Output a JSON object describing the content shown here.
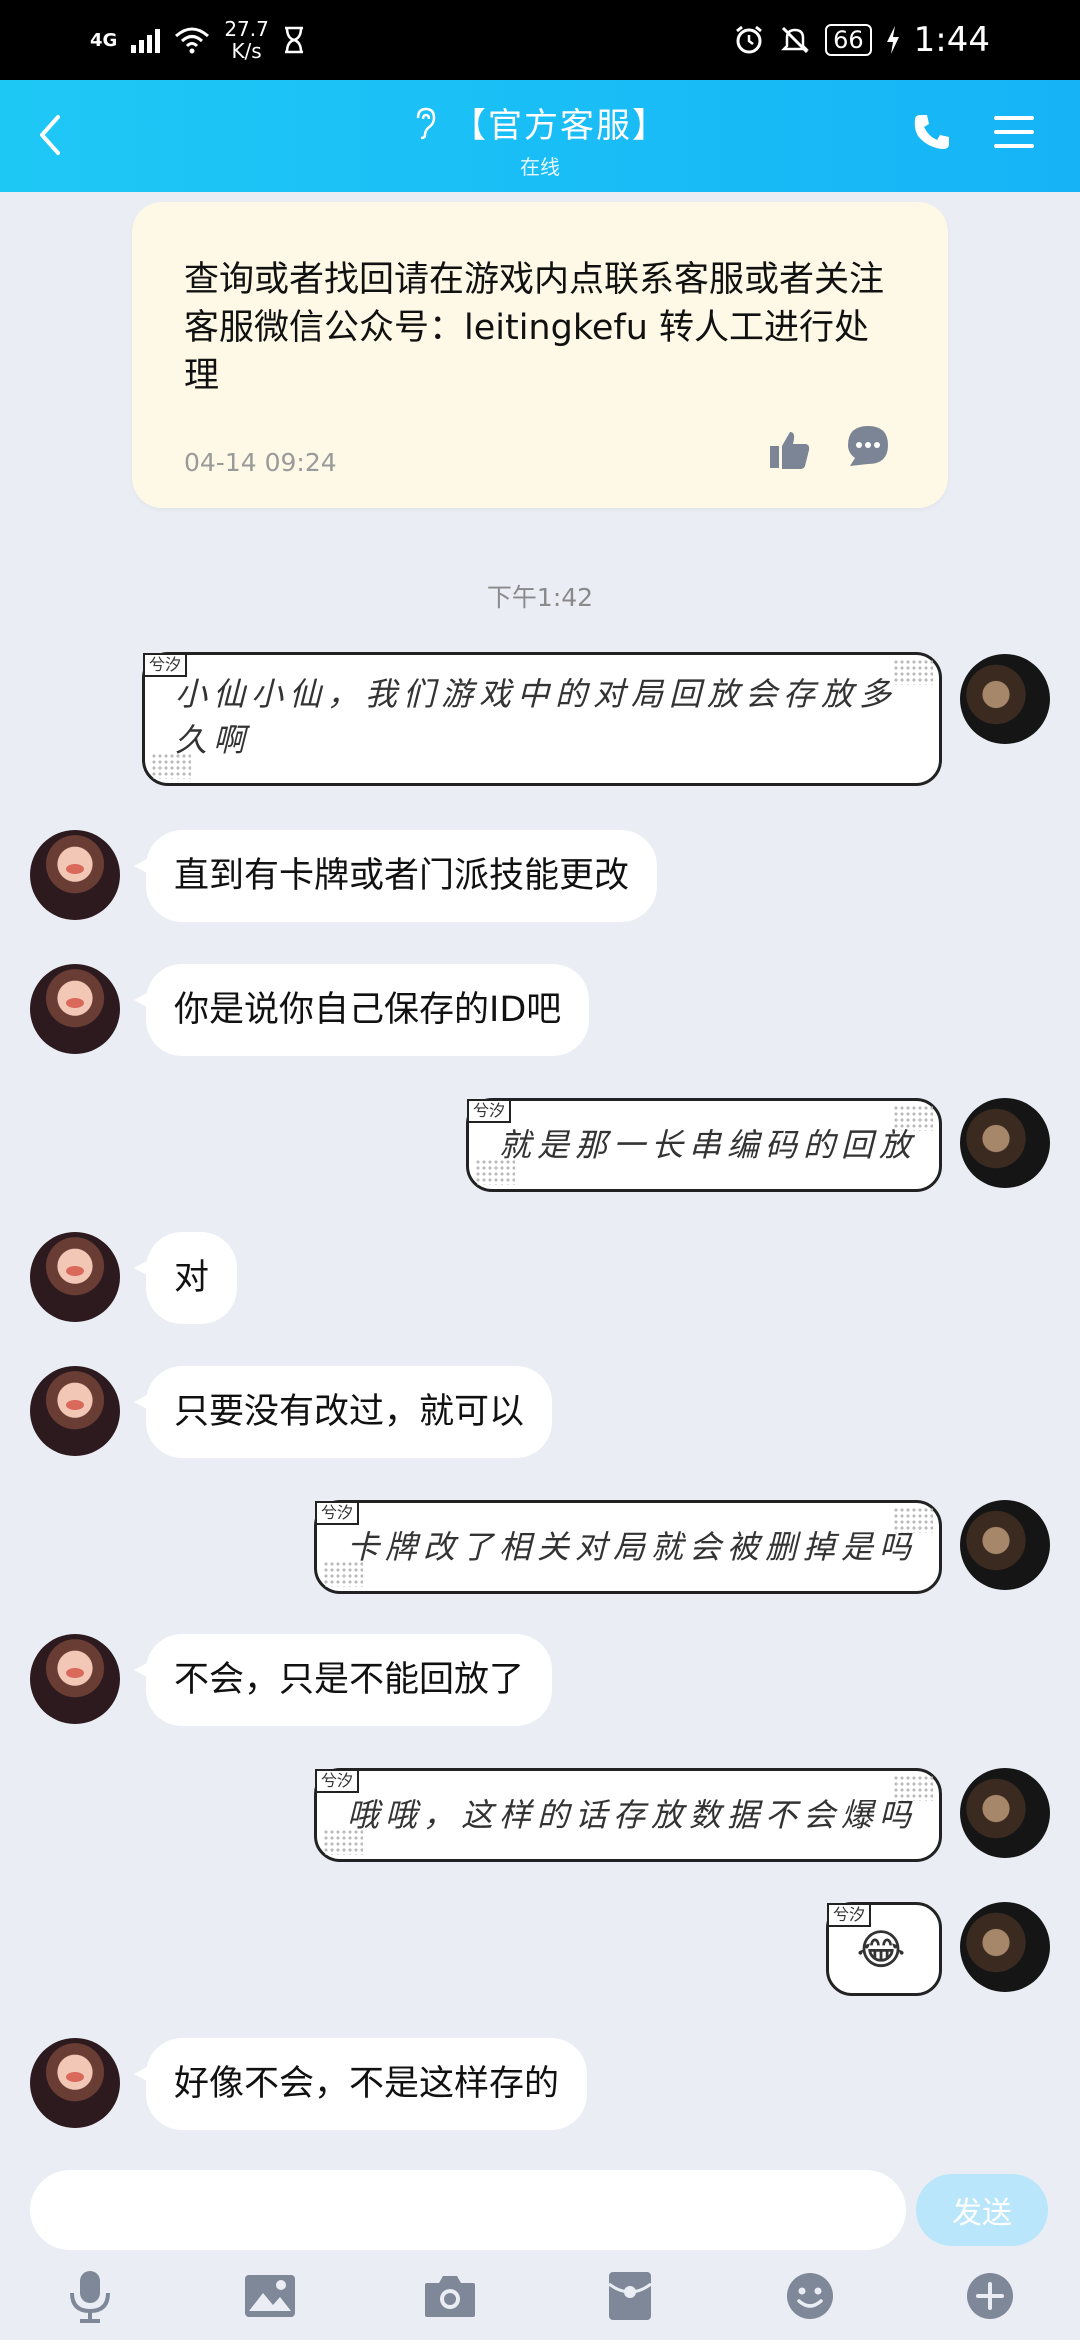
{
  "status_bar": {
    "network": "4G",
    "speed_value": "27.7",
    "speed_unit": "K/s",
    "battery": "66",
    "time": "1:44"
  },
  "header": {
    "title": "【官方客服】",
    "subtitle": "在线"
  },
  "notice": {
    "text": "查询或者找回请在游戏内点联系客服或者关注客服微信公众号：leitingkefu 转人工进行处理",
    "time": "04-14 09:24"
  },
  "time_separator": "下午1:42",
  "bubble_tag": "兮汐",
  "messages": [
    {
      "side": "right",
      "text": "小仙小仙，我们游戏中的对局回放会存放多久啊"
    },
    {
      "side": "left",
      "text": "直到有卡牌或者门派技能更改"
    },
    {
      "side": "left",
      "text": "你是说你自己保存的ID吧"
    },
    {
      "side": "right",
      "text": "就是那一长串编码的回放"
    },
    {
      "side": "left",
      "text": "对"
    },
    {
      "side": "left",
      "text": "只要没有改过，就可以"
    },
    {
      "side": "right",
      "text": "卡牌改了相关对局就会被删掉是吗"
    },
    {
      "side": "left",
      "text": "不会，只是不能回放了"
    },
    {
      "side": "right",
      "text": "哦哦，这样的话存放数据不会爆吗"
    },
    {
      "side": "right",
      "text": "😂"
    },
    {
      "side": "left",
      "text": "好像不会，不是这样存的"
    }
  ],
  "input": {
    "placeholder": "",
    "send_label": "发送"
  },
  "colors": {
    "header_accent": "#16b4f7",
    "send_disabled": "#b9e6fb",
    "notice_bg": "#fdf9e6",
    "chat_bg": "#eaedf4"
  },
  "toolbar_icons": [
    "microphone-icon",
    "image-icon",
    "camera-icon",
    "red-packet-icon",
    "emoji-icon",
    "plus-icon"
  ]
}
